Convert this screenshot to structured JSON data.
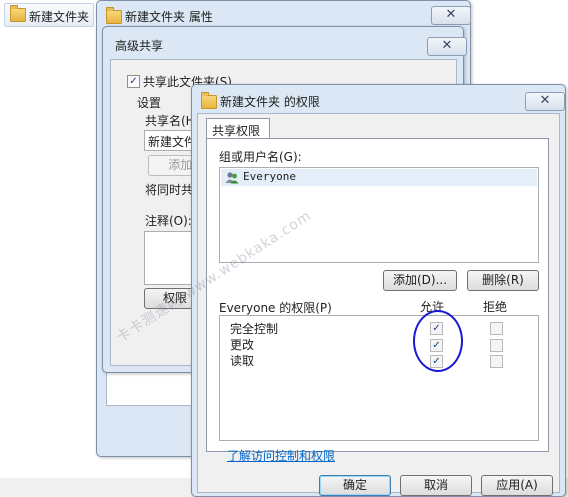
{
  "explorer": {
    "tab_label": "新建文件夹"
  },
  "properties_window": {
    "title": "新建文件夹 属性",
    "close": "✕"
  },
  "advanced_sharing": {
    "title": "高级共享",
    "close": "✕",
    "share_checkbox_label": "共享此文件夹(S)",
    "share_checked": true,
    "settings_group": "设置",
    "share_name_label": "共享名(H)",
    "share_name_value": "新建文件",
    "add_button": "添加(A)",
    "limit_label": "将同时共",
    "comment_label": "注释(O):",
    "permissions_button": "权限"
  },
  "permissions_dialog": {
    "title": "新建文件夹 的权限",
    "close": "✕",
    "tab": "共享权限",
    "group_label": "组或用户名(G):",
    "users": [
      {
        "name": "Everyone",
        "icon": "users-icon"
      }
    ],
    "add_button": "添加(D)...",
    "remove_button": "删除(R)",
    "perm_header": "Everyone 的权限(P)",
    "allow_header": "允许",
    "deny_header": "拒绝",
    "permissions": [
      {
        "name": "完全控制",
        "allow": true,
        "deny": false
      },
      {
        "name": "更改",
        "allow": true,
        "deny": false
      },
      {
        "name": "读取",
        "allow": true,
        "deny": false
      }
    ],
    "learn_link": "了解访问控制和权限",
    "ok_button": "确定",
    "cancel_button": "取消",
    "apply_button": "应用(A)"
  },
  "watermark": "卡卡测速网 www.webkaka.com",
  "colors": {
    "highlight_circle": "#1a1ad0",
    "link": "#0066cc"
  }
}
